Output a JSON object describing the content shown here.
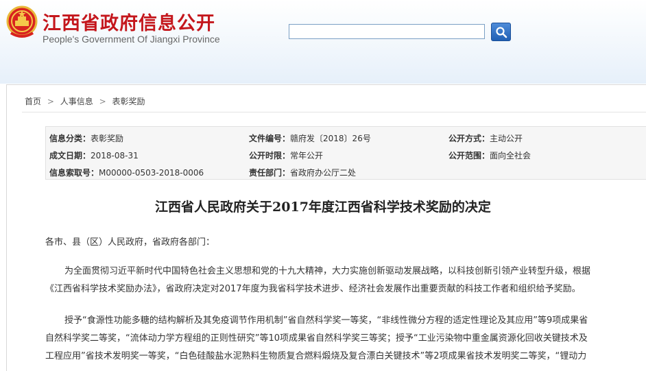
{
  "header": {
    "title_cn": "江西省政府信息公开",
    "title_en": "People's Government Of Jiangxi Province",
    "search_placeholder": ""
  },
  "breadcrumb": [
    "首页",
    "人事信息",
    "表彰奖励"
  ],
  "meta": {
    "category_label": "信息分类：",
    "category_value": "表彰奖励",
    "docno_label": "文件编号：",
    "docno_value": "赣府发〔2018〕26号",
    "method_label": "公开方式：",
    "method_value": "主动公开",
    "date_label": "成文日期：",
    "date_value": "2018-08-31",
    "period_label": "公开时限：",
    "period_value": "常年公开",
    "scope_label": "公开范围：",
    "scope_value": "面向全社会",
    "index_label": "信息索取号：",
    "index_value": "M00000-0503-2018-0006",
    "dept_label": "责任部门：",
    "dept_value": "省政府办公厅二处"
  },
  "document": {
    "title": "江西省人民政府关于2017年度江西省科学技术奖励的决定",
    "salutation": "各市、县（区）人民政府，省政府各部门：",
    "p1_l1": "为全面贯彻习近平新时代中国特色社会主义思想和党的十九大精神，大力实施创新驱动发展战略，以科技创新引领产业转型升级，根据",
    "p1_l2": "《江西省科学技术奖励办法》，省政府决定对2017年度为我省科学技术进步、经济社会发展作出重要贡献的科技工作者和组织给予奖励。",
    "p2_l1": "授予“食源性功能多糖的结构解析及其免疫调节作用机制”省自然科学奖一等奖，“非线性微分方程的适定性理论及其应用”等9项成果省",
    "p2_l2": "自然科学奖二等奖，“流体动力学方程组的正则性研究”等10项成果省自然科学奖三等奖；授予“工业污染物中重金属资源化回收关键技术及",
    "p2_l3": "工程应用”省技术发明奖一等奖，“白色硅酸盐水泥熟料生物质复合燃料煅烧及复合漂白关键技术”等2项成果省技术发明奖二等奖，“锂动力"
  },
  "colors": {
    "brand_red": "#c4161c",
    "search_blue": "#2a6cc4"
  }
}
